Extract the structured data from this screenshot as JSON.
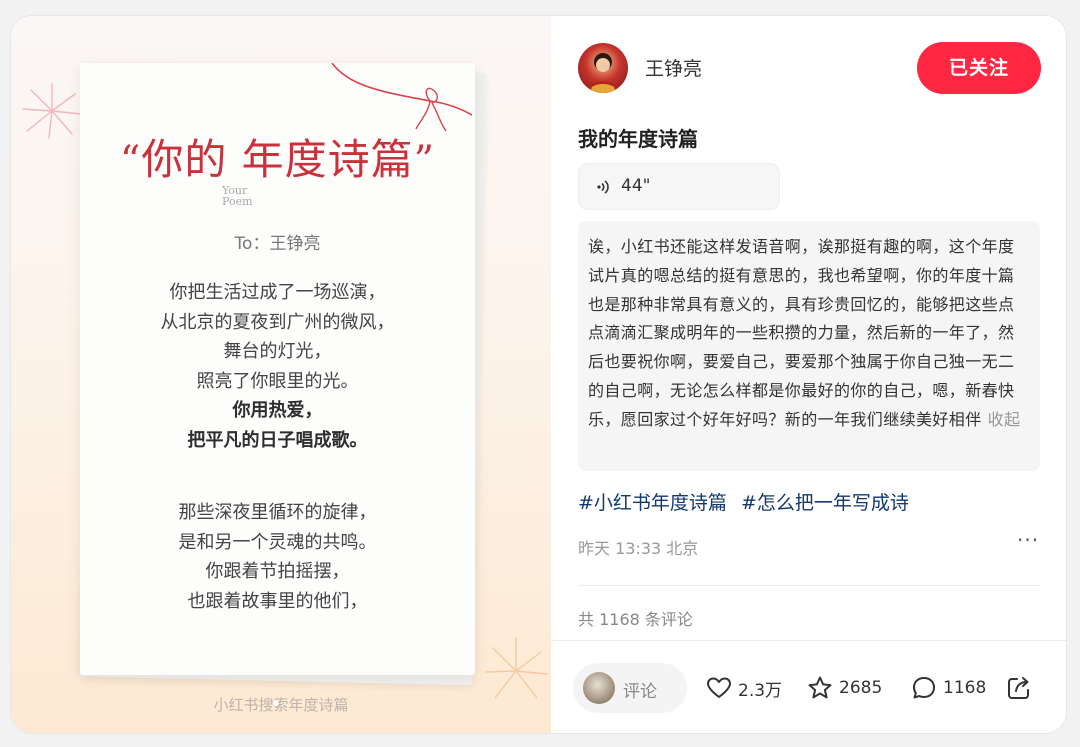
{
  "poem_image": {
    "title_quote_open": "“",
    "title_text": "你的 年度诗篇",
    "title_quote_close": "”",
    "your_poem_line1": "Your",
    "your_poem_line2": "Poem",
    "to_line": "To：王铮亮",
    "stanza1": [
      {
        "text": "你把生活过成了一场巡演，",
        "bold": false
      },
      {
        "text": "从北京的夏夜到广州的微风，",
        "bold": false
      },
      {
        "text": "舞台的灯光，",
        "bold": false
      },
      {
        "text": "照亮了你眼里的光。",
        "bold": false
      },
      {
        "text": "你用热爱，",
        "bold": true
      },
      {
        "text": "把平凡的日子唱成歌。",
        "bold": true
      }
    ],
    "stanza2": [
      "那些深夜里循环的旋律，",
      "是和另一个灵魂的共鸣。",
      "你跟着节拍摇摆，",
      "也跟着故事里的他们，"
    ],
    "watermark": "小红书搜索年度诗篇"
  },
  "post": {
    "author": "王铮亮",
    "follow_label": "已关注",
    "title": "我的年度诗篇",
    "voice_duration": "44\"",
    "transcript": "诶，小红书还能这样发语音啊，诶那挺有趣的啊，这个年度试片真的嗯总结的挺有意思的，我也希望啊，你的年度十篇也是那种非常具有意义的，具有珍贵回忆的，能够把这些点点滴滴汇聚成明年的一些积攒的力量，然后新的一年了，然后也要祝你啊，要爱自己，要爱那个独属于你自己独一无二的自己啊，无论怎么样都是你最好的你的自己，嗯，新春快乐，愿回家过个好年好吗？新的一年我们继续美好相伴",
    "collapse_label": "收起",
    "tags": [
      "#小红书年度诗篇",
      "#怎么把一年写成诗"
    ],
    "meta": "昨天 13:33 北京",
    "more": "···",
    "comment_count_label": "共 1168 条评论"
  },
  "actions": {
    "comment_input_label": "评论",
    "likes": "2.3万",
    "favorites": "2685",
    "comments": "1168"
  },
  "colors": {
    "accent": "#ff2741",
    "tag": "#13386c",
    "poem_red": "#c9313b"
  },
  "icons": [
    "heart-icon",
    "star-icon",
    "comment-bubble-icon",
    "share-icon",
    "voice-wave-icon"
  ]
}
